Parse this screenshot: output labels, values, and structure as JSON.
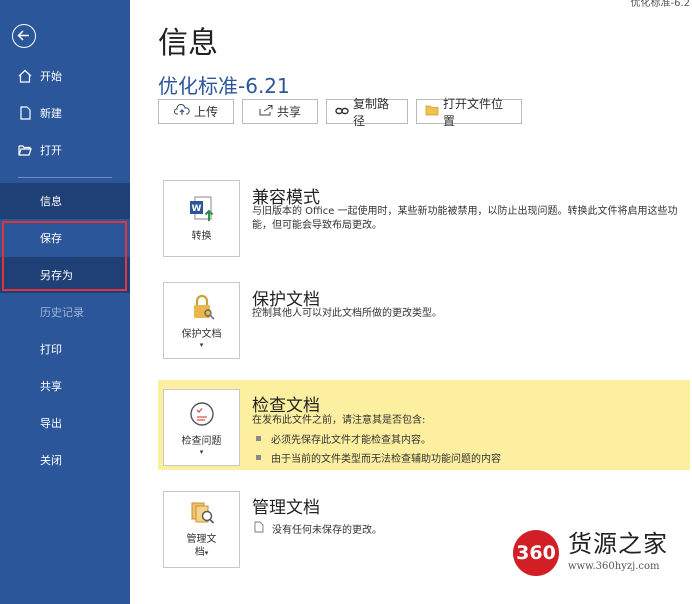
{
  "sidebar": {
    "back_label": "",
    "items": [
      {
        "label": "开始"
      },
      {
        "label": "新建"
      },
      {
        "label": "打开"
      },
      {
        "label": "信息"
      },
      {
        "label": "保存"
      },
      {
        "label": "另存为"
      },
      {
        "label": "历史记录"
      },
      {
        "label": "打印"
      },
      {
        "label": "共享"
      },
      {
        "label": "导出"
      },
      {
        "label": "关闭"
      }
    ],
    "active_item": "信息"
  },
  "header": {
    "title": "信息",
    "top_right_text": "优化标准-6.2",
    "document_name": "优化标准-6.21"
  },
  "toolbar": {
    "upload_label": "上传",
    "share_label": "共享",
    "copy_path_label": "复制路径",
    "open_location_label": "打开文件位置"
  },
  "sections": {
    "compat": {
      "button_label": "转换",
      "title": "兼容模式",
      "description": "与旧版本的 Office 一起使用时，某些新功能被禁用，以防止出现问题。转换此文件将启用这些功能，但可能会导致布局更改。"
    },
    "protect": {
      "button_label": "保护文档",
      "title": "保护文档",
      "description": "控制其他人可以对此文档所做的更改类型。"
    },
    "inspect": {
      "button_label": "检查问题",
      "title": "检查文档",
      "description": "在发布此文件之前，请注意其是否包含:",
      "bullets": [
        "必须先保存此文件才能检查其内容。",
        "由于当前的文件类型而无法检查辅助功能问题的内容"
      ]
    },
    "manage": {
      "button_label_1": "管理文",
      "button_label_2": "档",
      "title": "管理文档",
      "description": "没有任何未保存的更改。"
    }
  },
  "watermark": {
    "badge": "360",
    "title": "货源之家",
    "url": "www.360hyzj.com"
  },
  "colors": {
    "sidebar_bg": "#2b579a",
    "sidebar_active": "#1e4076",
    "highlight_border": "#e0353b",
    "inspect_bg": "#fdefa0",
    "accent": "#2b579a"
  }
}
